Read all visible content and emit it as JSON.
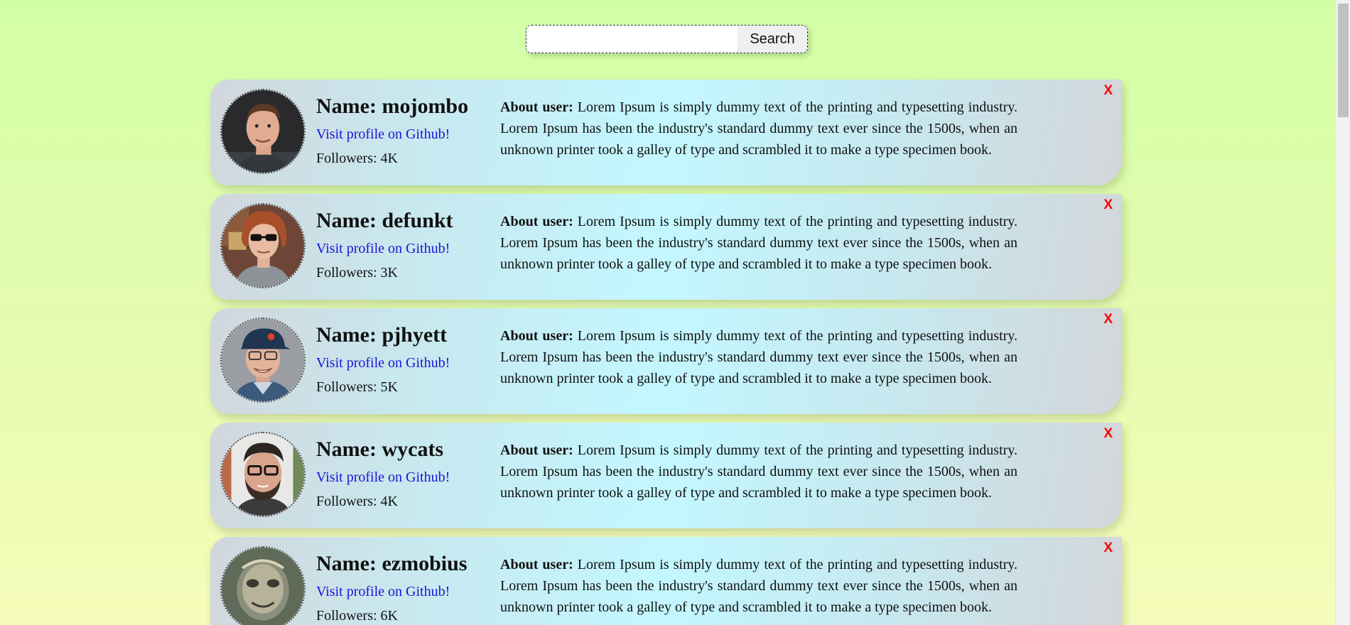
{
  "search": {
    "placeholder": "",
    "value": "",
    "button_label": "Search"
  },
  "users": [
    {
      "name": "Name: mojombo",
      "link": "Visit profile on Github!",
      "followers": "Followers: 4K",
      "about_label": "About user:",
      "about_text": " Lorem Ipsum is simply dummy text of the printing and typesetting industry. Lorem Ipsum has been the industry's standard dummy text ever since the 1500s, when an unknown printer took a galley of type and scrambled it to make a type specimen book.",
      "close": "X"
    },
    {
      "name": "Name: defunkt",
      "link": "Visit profile on Github!",
      "followers": "Followers: 3K",
      "about_label": "About user:",
      "about_text": " Lorem Ipsum is simply dummy text of the printing and typesetting industry. Lorem Ipsum has been the industry's standard dummy text ever since the 1500s, when an unknown printer took a galley of type and scrambled it to make a type specimen book.",
      "close": "X"
    },
    {
      "name": "Name: pjhyett",
      "link": "Visit profile on Github!",
      "followers": "Followers: 5K",
      "about_label": "About user:",
      "about_text": " Lorem Ipsum is simply dummy text of the printing and typesetting industry. Lorem Ipsum has been the industry's standard dummy text ever since the 1500s, when an unknown printer took a galley of type and scrambled it to make a type specimen book.",
      "close": "X"
    },
    {
      "name": "Name: wycats",
      "link": "Visit profile on Github!",
      "followers": "Followers: 4K",
      "about_label": "About user:",
      "about_text": " Lorem Ipsum is simply dummy text of the printing and typesetting industry. Lorem Ipsum has been the industry's standard dummy text ever since the 1500s, when an unknown printer took a galley of type and scrambled it to make a type specimen book.",
      "close": "X"
    },
    {
      "name": "Name: ezmobius",
      "link": "Visit profile on Github!",
      "followers": "Followers: 6K",
      "about_label": "About user:",
      "about_text": " Lorem Ipsum is simply dummy text of the printing and typesetting industry. Lorem Ipsum has been the industry's standard dummy text ever since the 1500s, when an unknown printer took a galley of type and scrambled it to make a type specimen book.",
      "close": "X"
    }
  ],
  "colors": {
    "link": "#1a14d8",
    "close": "#ff0000",
    "background_top": "#d2ffa6",
    "background_bottom": "#f5fcb9"
  }
}
